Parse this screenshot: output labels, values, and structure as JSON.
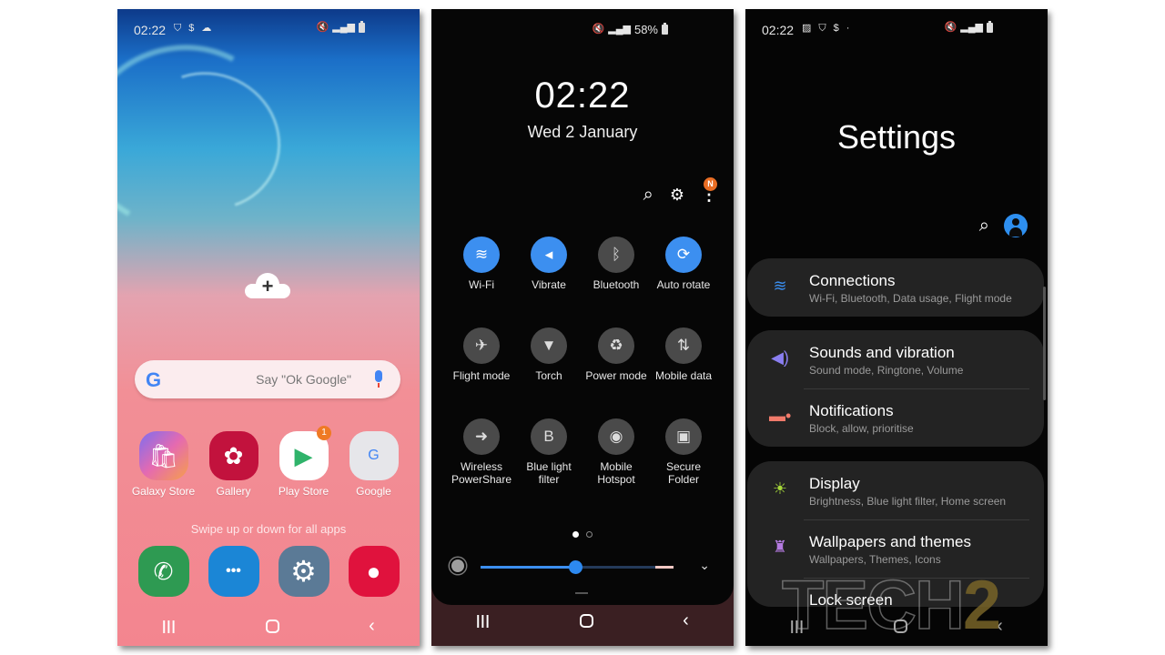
{
  "home": {
    "status": {
      "time": "02:22",
      "left_icons": [
        "shield-icon",
        "samsung-pass-icon",
        "cloud-icon"
      ],
      "right_icons": [
        "mute-vibrate-icon",
        "signal-icon",
        "battery-icon"
      ]
    },
    "add_widget_label": "+",
    "search": {
      "logo": "G",
      "placeholder": "Say \"Ok Google\""
    },
    "apps": [
      {
        "label": "Galaxy Store",
        "icon": "shopping-bag-icon",
        "glyph": "🛍",
        "badge": ""
      },
      {
        "label": "Gallery",
        "icon": "flower-icon",
        "glyph": "✿",
        "badge": ""
      },
      {
        "label": "Play Store",
        "icon": "play-store-icon",
        "glyph": "▶",
        "badge": "1"
      },
      {
        "label": "Google",
        "icon": "google-folder-icon",
        "glyph": "G",
        "badge": ""
      }
    ],
    "swipe_hint": "Swipe up or down for all apps",
    "dock": [
      {
        "label": "Phone",
        "icon": "phone-icon",
        "glyph": "✆"
      },
      {
        "label": "Messages",
        "icon": "messages-icon",
        "glyph": "•••"
      },
      {
        "label": "Settings",
        "icon": "gear-icon",
        "glyph": "⚙"
      },
      {
        "label": "Camera",
        "icon": "camera-icon",
        "glyph": "●"
      }
    ],
    "nav": {
      "recents": "|||",
      "home": "",
      "back": "‹"
    }
  },
  "quick_panel": {
    "status": {
      "battery": "58%"
    },
    "clock": "02:22",
    "date": "Wed 2 January",
    "tools": {
      "search": "⌕",
      "settings": "⚙",
      "more": "⋮",
      "more_badge": "N"
    },
    "tiles": [
      {
        "label": "Wi-Fi",
        "icon": "wifi-icon",
        "glyph": "≋",
        "on": true
      },
      {
        "label": "Vibrate",
        "icon": "vibrate-icon",
        "glyph": "◂",
        "on": true
      },
      {
        "label": "Bluetooth",
        "icon": "bluetooth-icon",
        "glyph": "ᛒ",
        "on": false
      },
      {
        "label": "Auto rotate",
        "icon": "auto-rotate-icon",
        "glyph": "⟳",
        "on": true
      },
      {
        "label": "Flight mode",
        "icon": "airplane-icon",
        "glyph": "✈",
        "on": false
      },
      {
        "label": "Torch",
        "icon": "torch-icon",
        "glyph": "▼",
        "on": false
      },
      {
        "label": "Power mode",
        "icon": "power-mode-icon",
        "glyph": "♻",
        "on": false
      },
      {
        "label": "Mobile data",
        "icon": "mobile-data-icon",
        "glyph": "⇅",
        "on": false
      },
      {
        "label": "Wireless PowerShare",
        "icon": "powershare-icon",
        "glyph": "➜",
        "on": false
      },
      {
        "label": "Blue light filter",
        "icon": "blue-light-icon",
        "glyph": "B",
        "on": false
      },
      {
        "label": "Mobile Hotspot",
        "icon": "hotspot-icon",
        "glyph": "◉",
        "on": false
      },
      {
        "label": "Secure Folder",
        "icon": "secure-folder-icon",
        "glyph": "▣",
        "on": false
      }
    ],
    "page": {
      "current": 1,
      "total": 2
    },
    "brightness_percent": 49,
    "expand": "⌄",
    "nav": {
      "recents": "|||",
      "back": "‹"
    }
  },
  "settings": {
    "status": {
      "time": "02:22"
    },
    "title": "Settings",
    "search": "⌕",
    "groups": [
      [
        {
          "title": "Connections",
          "subtitle": "Wi-Fi, Bluetooth, Data usage, Flight mode",
          "icon": "wifi-icon",
          "glyph": "≋",
          "color": "#3a8ef0"
        }
      ],
      [
        {
          "title": "Sounds and vibration",
          "subtitle": "Sound mode, Ringtone, Volume",
          "icon": "speaker-icon",
          "glyph": "◀)",
          "color": "#8a7ef0"
        },
        {
          "title": "Notifications",
          "subtitle": "Block, allow, prioritise",
          "icon": "notifications-icon",
          "glyph": "▬•",
          "color": "#f07a6a"
        }
      ],
      [
        {
          "title": "Display",
          "subtitle": "Brightness, Blue light filter, Home screen",
          "icon": "sun-icon",
          "glyph": "☀",
          "color": "#a6d83a"
        },
        {
          "title": "Wallpapers and themes",
          "subtitle": "Wallpapers, Themes, Icons",
          "icon": "brush-icon",
          "glyph": "♜",
          "color": "#b47ae0"
        },
        {
          "title": "Lock screen",
          "subtitle": "",
          "icon": "",
          "glyph": "",
          "color": ""
        }
      ]
    ],
    "watermark": {
      "text": "TECH",
      "digit": "2"
    },
    "nav": {
      "recents": "|||",
      "back": "‹"
    }
  }
}
